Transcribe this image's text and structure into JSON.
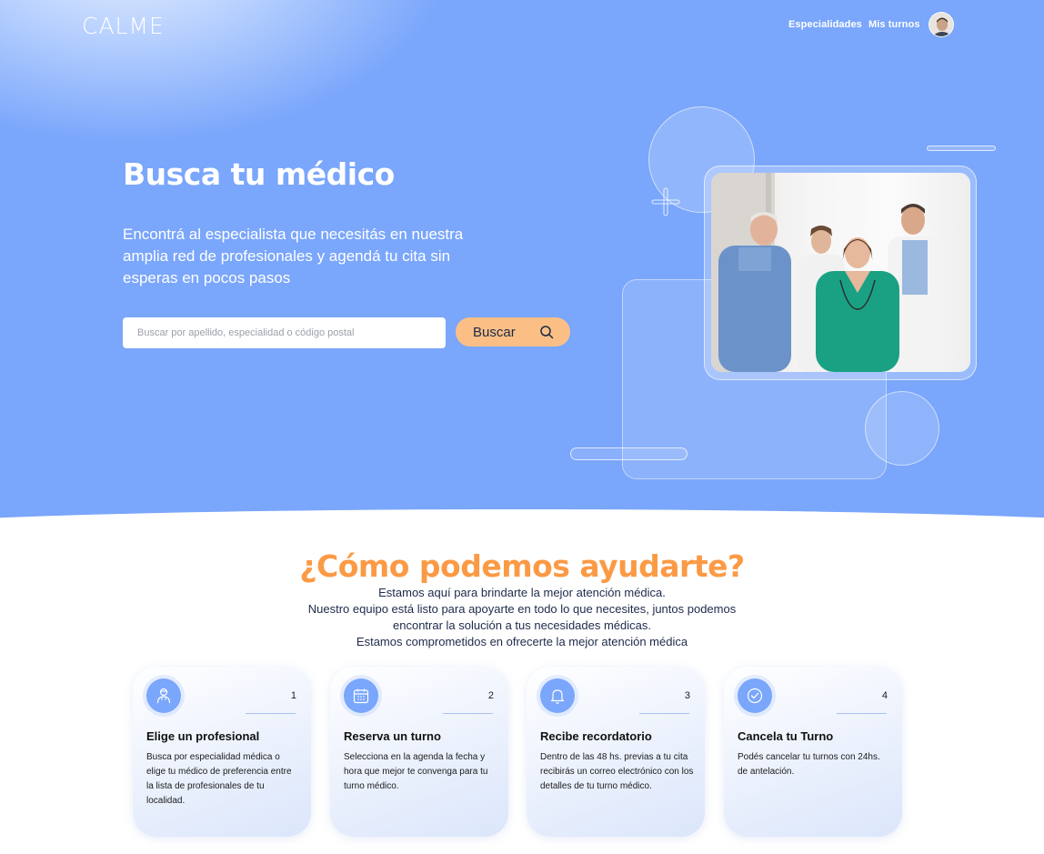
{
  "header": {
    "logo": "CALME",
    "nav": [
      {
        "label": "Especialidades"
      },
      {
        "label": "Mis turnos"
      }
    ]
  },
  "hero": {
    "title": "Busca tu médico",
    "subtitle": "Encontrá al especialista que necesitás en nuestra amplia red de profesionales y agendá tu cita sin esperas en pocos pasos",
    "search": {
      "placeholder": "Buscar por apellido, especialidad o código postal",
      "value": "",
      "button_label": "Buscar"
    }
  },
  "help": {
    "title": "¿Cómo podemos ayudarte?",
    "lines": [
      "Estamos aquí para brindarte la mejor atención médica.",
      "Nuestro equipo está listo para apoyarte en todo lo que necesites, juntos podemos",
      "encontrar la solución a tus necesidades médicas.",
      "Estamos comprometidos en ofrecerte la mejor atención médica"
    ]
  },
  "cards": [
    {
      "number": "1",
      "title": "Elige un profesional",
      "text": "Busca por especialidad médica o elige tu médico de preferencia entre la lista de profesionales de tu localidad.",
      "icon": "doctor-icon"
    },
    {
      "number": "2",
      "title": "Reserva un turno",
      "text": "Selecciona en la agenda la fecha y hora que mejor te convenga para tu turno médico.",
      "icon": "calendar-icon"
    },
    {
      "number": "3",
      "title": "Recibe recordatorio",
      "text": "Dentro de las 48 hs. previas a tu cita recibirás un correo electrónico con los detalles de tu turno médico.",
      "icon": "bell-icon"
    },
    {
      "number": "4",
      "title": "Cancela tu Turno",
      "text": "Podés cancelar tu turnos con 24hs. de antelación.",
      "icon": "check-circle-icon"
    }
  ],
  "colors": {
    "hero_blue": "#7aa6fb",
    "accent_orange": "#fb9a45",
    "button_peach": "#fbbf86"
  }
}
